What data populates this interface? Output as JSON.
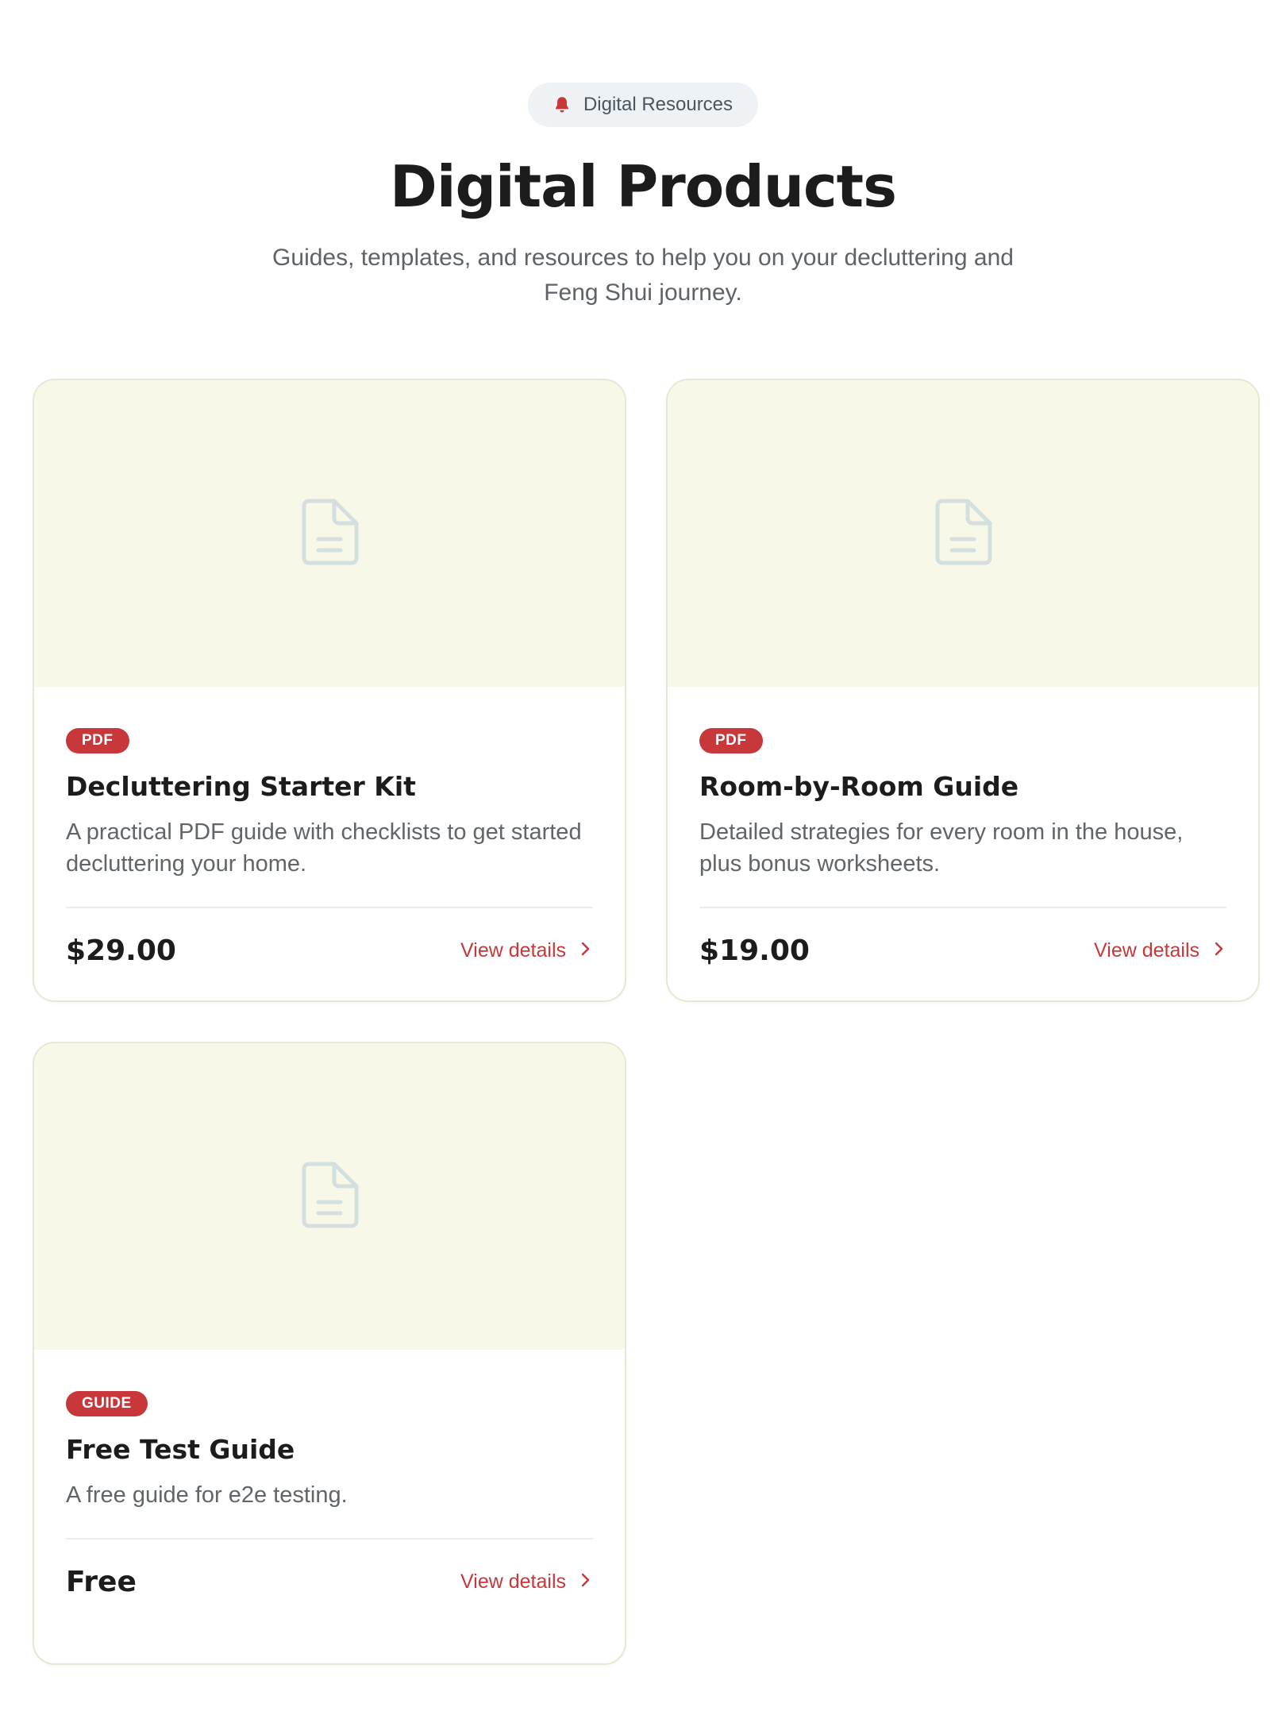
{
  "header": {
    "pill_label": "Digital Resources",
    "pill_icon": "bell-icon",
    "title": "Digital Products",
    "subtitle": "Guides, templates, and resources to help you on your decluttering and Feng Shui journey."
  },
  "colors": {
    "accent": "#c8373a",
    "thumb_bg": "#f7f8e8",
    "card_border": "#e6e8d2",
    "icon_color": "#d4e0df"
  },
  "products": [
    {
      "badge": "PDF",
      "name": "Decluttering Starter Kit",
      "description": "A practical PDF guide with checklists to get started decluttering your home.",
      "price": "$29.00",
      "link": "View details",
      "thumb_icon": "document-icon"
    },
    {
      "badge": "PDF",
      "name": "Room-by-Room Guide",
      "description": "Detailed strategies for every room in the house, plus bonus worksheets.",
      "price": "$19.00",
      "link": "View details",
      "thumb_icon": "document-icon"
    },
    {
      "badge": "GUIDE",
      "name": "Free Test Guide",
      "description": "A free guide for e2e testing.",
      "price": "Free",
      "link": "View details",
      "thumb_icon": "document-icon"
    }
  ]
}
